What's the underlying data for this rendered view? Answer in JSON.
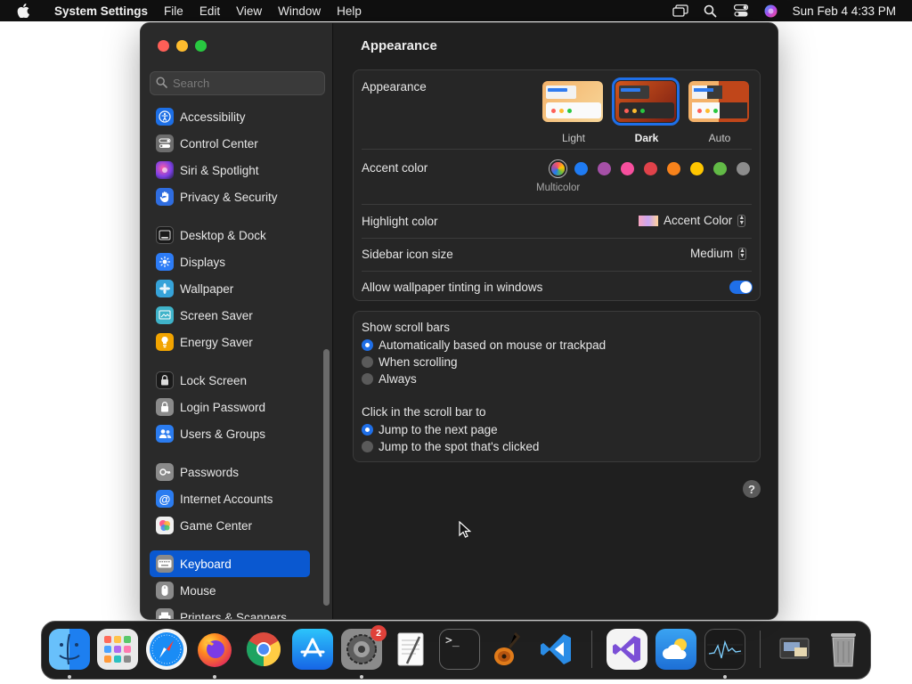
{
  "menubar": {
    "app_name": "System Settings",
    "items": [
      "File",
      "Edit",
      "View",
      "Window",
      "Help"
    ],
    "datetime": "Sun Feb 4  4:33 PM"
  },
  "sidebar": {
    "search_placeholder": "Search",
    "items": [
      {
        "label": "Accessibility",
        "icon": "accessibility-icon",
        "color": "#1d6fe6"
      },
      {
        "label": "Control Center",
        "icon": "control-center-icon",
        "color": "#6d6d6d"
      },
      {
        "label": "Siri & Spotlight",
        "icon": "siri-icon",
        "color": "#7b3fe4"
      },
      {
        "label": "Privacy & Security",
        "icon": "privacy-hand-icon",
        "color": "#2f6de0"
      },
      {
        "label": "Desktop & Dock",
        "icon": "desktop-dock-icon",
        "color": "#1a1a1a"
      },
      {
        "label": "Displays",
        "icon": "displays-icon",
        "color": "#2d7cf6"
      },
      {
        "label": "Wallpaper",
        "icon": "wallpaper-icon",
        "color": "#36a3d9"
      },
      {
        "label": "Screen Saver",
        "icon": "screen-saver-icon",
        "color": "#3fb3c9"
      },
      {
        "label": "Energy Saver",
        "icon": "energy-saver-icon",
        "color": "#f2a400"
      },
      {
        "label": "Lock Screen",
        "icon": "lock-screen-icon",
        "color": "#1a1a1a"
      },
      {
        "label": "Login Password",
        "icon": "login-password-icon",
        "color": "#8a8a8a"
      },
      {
        "label": "Users & Groups",
        "icon": "users-groups-icon",
        "color": "#2b7cf0"
      },
      {
        "label": "Passwords",
        "icon": "passwords-icon",
        "color": "#8a8a8a"
      },
      {
        "label": "Internet Accounts",
        "icon": "internet-accounts-icon",
        "color": "#2b7cf0"
      },
      {
        "label": "Game Center",
        "icon": "game-center-icon",
        "color": "#e8e8e8"
      },
      {
        "label": "Keyboard",
        "icon": "keyboard-icon",
        "color": "#8a8a8a"
      },
      {
        "label": "Mouse",
        "icon": "mouse-icon",
        "color": "#8a8a8a"
      },
      {
        "label": "Printers & Scanners",
        "icon": "printer-icon",
        "color": "#8a8a8a"
      }
    ],
    "selected": "Keyboard"
  },
  "main": {
    "title": "Appearance",
    "appearance": {
      "label": "Appearance",
      "options": [
        "Light",
        "Dark",
        "Auto"
      ],
      "selected": "Dark"
    },
    "accent": {
      "label": "Accent color",
      "colors": [
        "multicolor",
        "#1f7bf2",
        "#a550a7",
        "#f74f9e",
        "#e0424a",
        "#f7821b",
        "#ffc600",
        "#62ba46",
        "#8c8c8c"
      ],
      "selected_label": "Multicolor"
    },
    "highlight": {
      "label": "Highlight color",
      "value": "Accent Color"
    },
    "sidebar_icon_size": {
      "label": "Sidebar icon size",
      "value": "Medium"
    },
    "tinting": {
      "label": "Allow wallpaper tinting in windows",
      "enabled": true
    },
    "scroll_bars": {
      "label": "Show scroll bars",
      "options": [
        "Automatically based on mouse or trackpad",
        "When scrolling",
        "Always"
      ],
      "selected": 0
    },
    "click_scroll": {
      "label": "Click in the scroll bar to",
      "options": [
        "Jump to the next page",
        "Jump to the spot that's clicked"
      ],
      "selected": 0
    },
    "help": "?"
  },
  "dock": {
    "apps": [
      "Finder",
      "Launchpad",
      "Safari",
      "Firefox",
      "Chrome",
      "App Store",
      "System Settings",
      "TextEdit",
      "Terminal",
      "GarageBand",
      "Visual Studio Code",
      "Visual Studio",
      "Weather",
      "Activity Monitor",
      "Downloads",
      "Trash"
    ],
    "system_settings_badge": "2"
  }
}
